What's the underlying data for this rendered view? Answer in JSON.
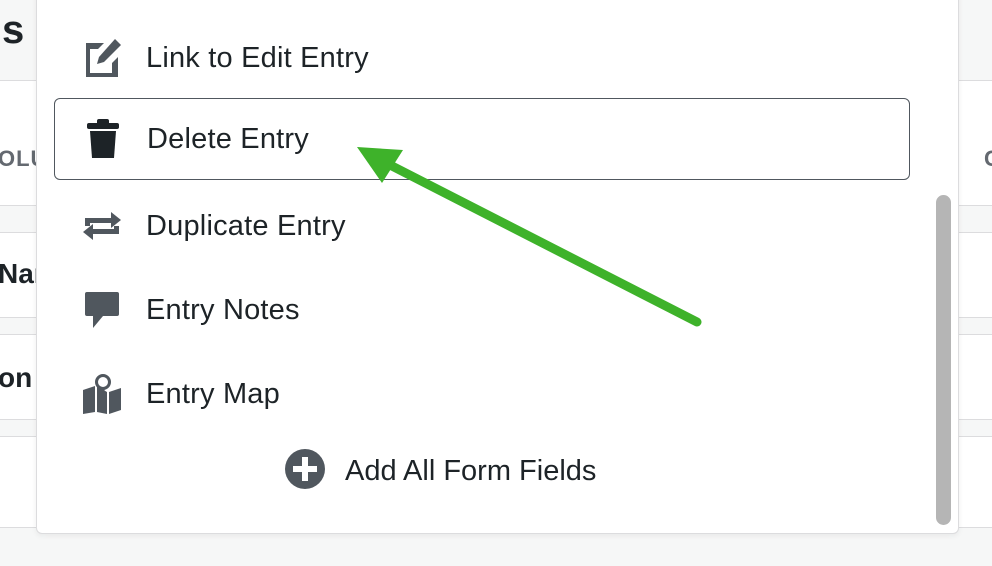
{
  "background": {
    "left_texts": [
      "s",
      "OLU",
      "Nar",
      "on"
    ],
    "right_texts": [
      "C"
    ]
  },
  "menu": {
    "items": [
      {
        "label": "Link to Edit Entry",
        "icon": "edit-icon"
      },
      {
        "label": "Delete Entry",
        "icon": "trash-icon",
        "selected": true
      },
      {
        "label": "Duplicate Entry",
        "icon": "duplicate-icon"
      },
      {
        "label": "Entry Notes",
        "icon": "comment-icon"
      },
      {
        "label": "Entry Map",
        "icon": "map-icon"
      }
    ],
    "add_all_label": "Add All Form Fields",
    "add_all_icon": "plus-circle-icon"
  },
  "colors": {
    "icon": "#50575e",
    "selected_border": "#50575e",
    "arrow": "#3eb22a",
    "scrollbar": "#b5b5b5"
  }
}
